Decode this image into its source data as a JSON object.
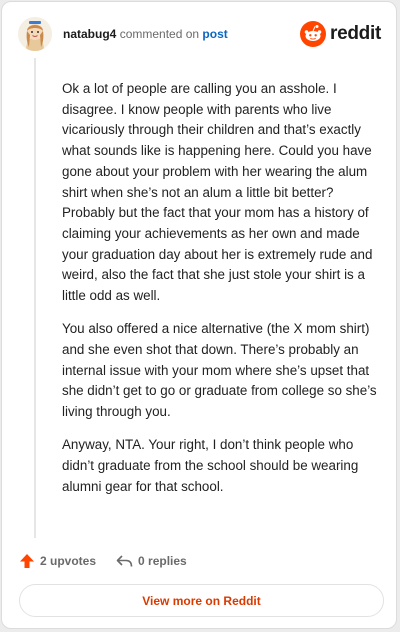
{
  "header": {
    "username": "natabug4",
    "action": "commented on",
    "post_link": "post",
    "brand": "reddit"
  },
  "comment": {
    "paragraphs": [
      "Ok a lot of people are calling you an asshole. I disagree. I know people with parents who live vicariously through their children and that’s exactly what sounds like is happening here. Could you have gone about your problem with her wearing the alum shirt when she’s not an alum a little bit better? Probably but the fact that your mom has a history of claiming your achievements as her own and made your graduation day about her is extremely rude and weird, also the fact that she just stole your shirt is a little odd as well.",
      "You also offered a nice alternative (the X mom shirt) and she even shot that down. There’s probably an internal issue with your mom where she’s upset that she didn’t get to go or graduate from college so she’s living through you.",
      "Anyway, NTA. Your right, I don’t think people who didn’t graduate from the school should be wearing alumni gear for that school."
    ]
  },
  "actions": {
    "upvotes": "2 upvotes",
    "replies": "0 replies"
  },
  "footer": {
    "view_more": "View more on Reddit"
  },
  "colors": {
    "brand_orange": "#ff4500",
    "link_blue": "#0a66c2",
    "view_more_text": "#d93a00"
  },
  "icons": [
    "avatar-illustration",
    "reddit-snoo-icon",
    "upvote-arrow-icon",
    "reply-arrow-icon"
  ]
}
